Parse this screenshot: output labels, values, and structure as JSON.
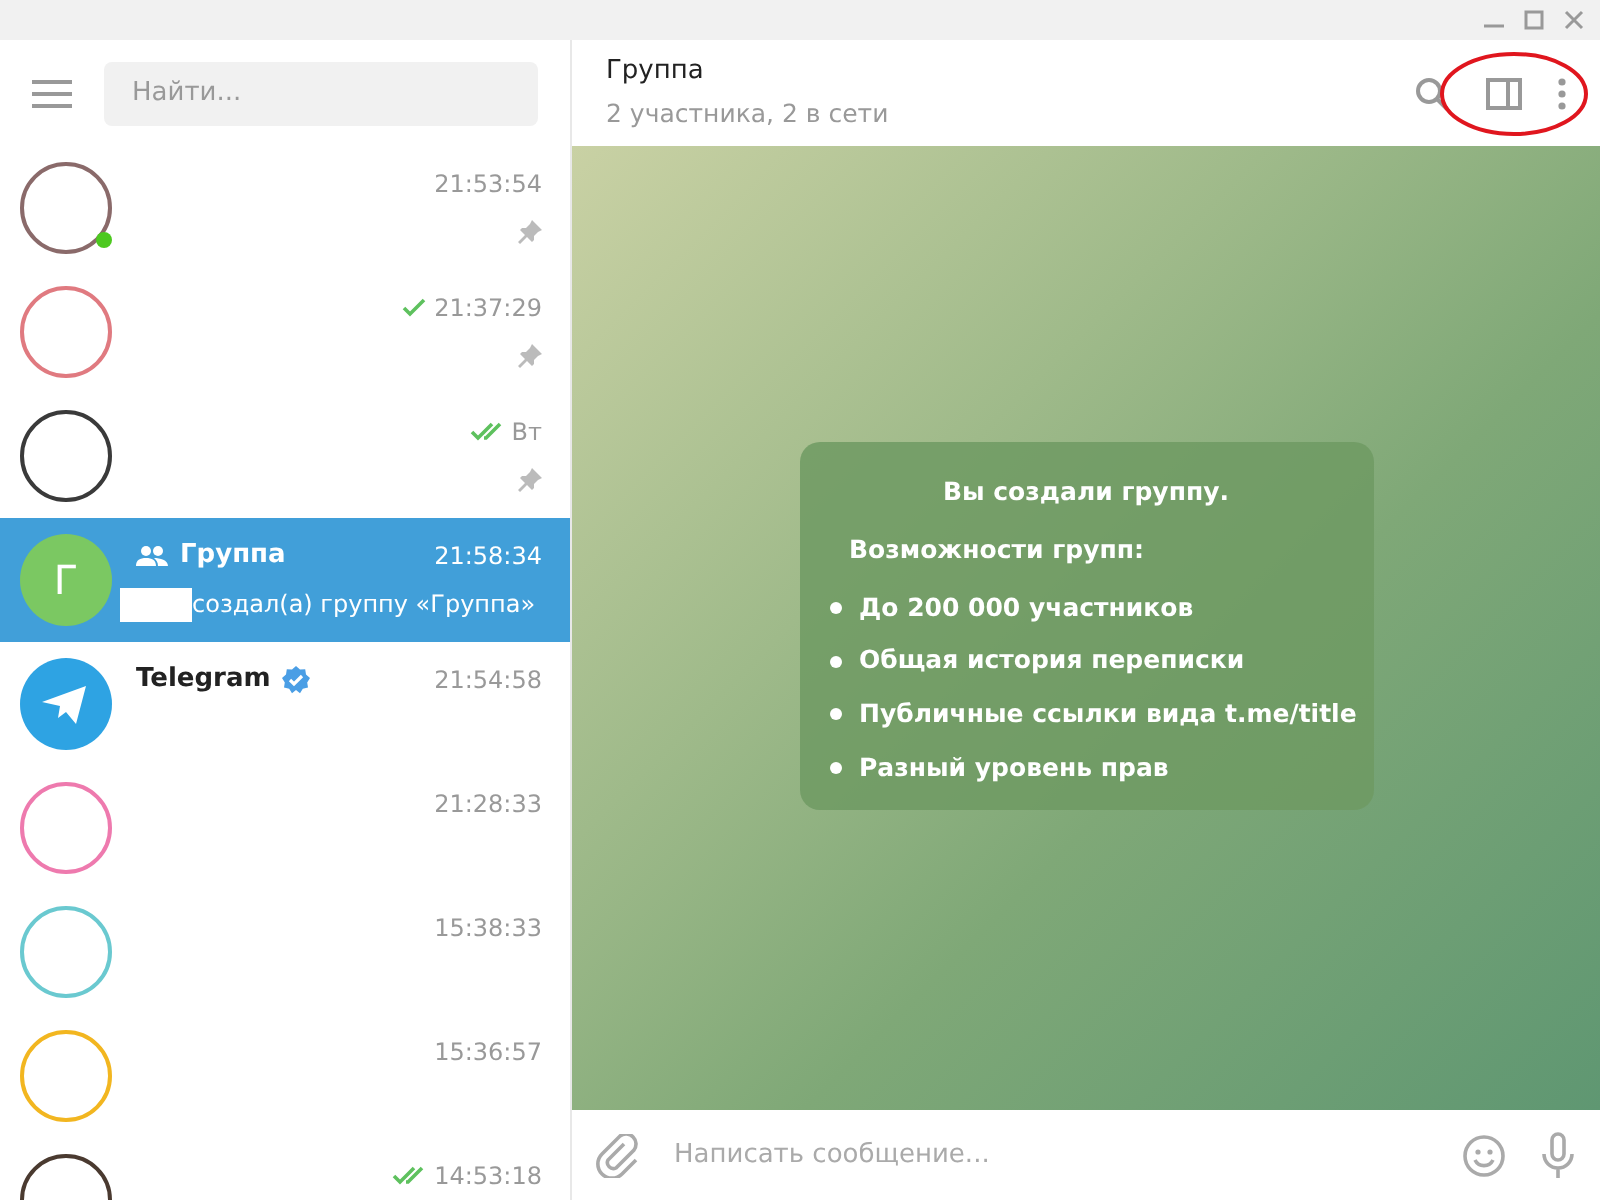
{
  "sidebar": {
    "search": {
      "placeholder": "Найти..."
    },
    "chats": [
      {
        "avatar": {
          "kind": "ring",
          "color": "#8a6a6a"
        },
        "online": true,
        "sent": false,
        "time": "21:53:54",
        "pinned": true,
        "selected": false
      },
      {
        "avatar": {
          "kind": "ring",
          "color": "#e07a80"
        },
        "online": false,
        "sent": true,
        "read": false,
        "time": "21:37:29",
        "pinned": true,
        "selected": false
      },
      {
        "avatar": {
          "kind": "ring",
          "color": "#3a3a3a"
        },
        "online": false,
        "sent": true,
        "read": true,
        "time": "Вт",
        "pinned": true,
        "selected": false
      },
      {
        "avatar": {
          "kind": "letter",
          "letter": "Г",
          "color": "#7bc862"
        },
        "group": true,
        "name": "Группа",
        "online": false,
        "sent": false,
        "time": "21:58:34",
        "preview": "создал(а) группу «Группа»",
        "redacted_sender": true,
        "pinned": false,
        "selected": true
      },
      {
        "avatar": {
          "kind": "logo",
          "color": "#2ea3e3"
        },
        "name": "Telegram",
        "verified": true,
        "online": false,
        "sent": false,
        "time": "21:54:58",
        "pinned": false,
        "selected": false
      },
      {
        "avatar": {
          "kind": "ring",
          "color": "#ee7aae"
        },
        "online": false,
        "sent": false,
        "time": "21:28:33",
        "pinned": false,
        "selected": false
      },
      {
        "avatar": {
          "kind": "ring",
          "color": "#6ac9d0"
        },
        "online": false,
        "sent": false,
        "time": "15:38:33",
        "pinned": false,
        "selected": false
      },
      {
        "avatar": {
          "kind": "ring",
          "color": "#f2b620"
        },
        "online": false,
        "sent": false,
        "time": "15:36:57",
        "pinned": false,
        "selected": false
      },
      {
        "avatar": {
          "kind": "ring",
          "color": "#4a3a30"
        },
        "online": false,
        "sent": true,
        "read": true,
        "time": "14:53:18",
        "pinned": false,
        "selected": false
      }
    ]
  },
  "chat": {
    "title": "Группа",
    "subtitle": "2 участника, 2 в сети",
    "service_message": {
      "title": "Вы создали группу.",
      "subtitle": "Возможности групп:",
      "items": [
        "До 200 000 участников",
        "Общая история переписки",
        "Публичные ссылки вида t.me/title",
        "Разный уровень прав"
      ]
    },
    "composer": {
      "placeholder": "Написать сообщение..."
    }
  }
}
